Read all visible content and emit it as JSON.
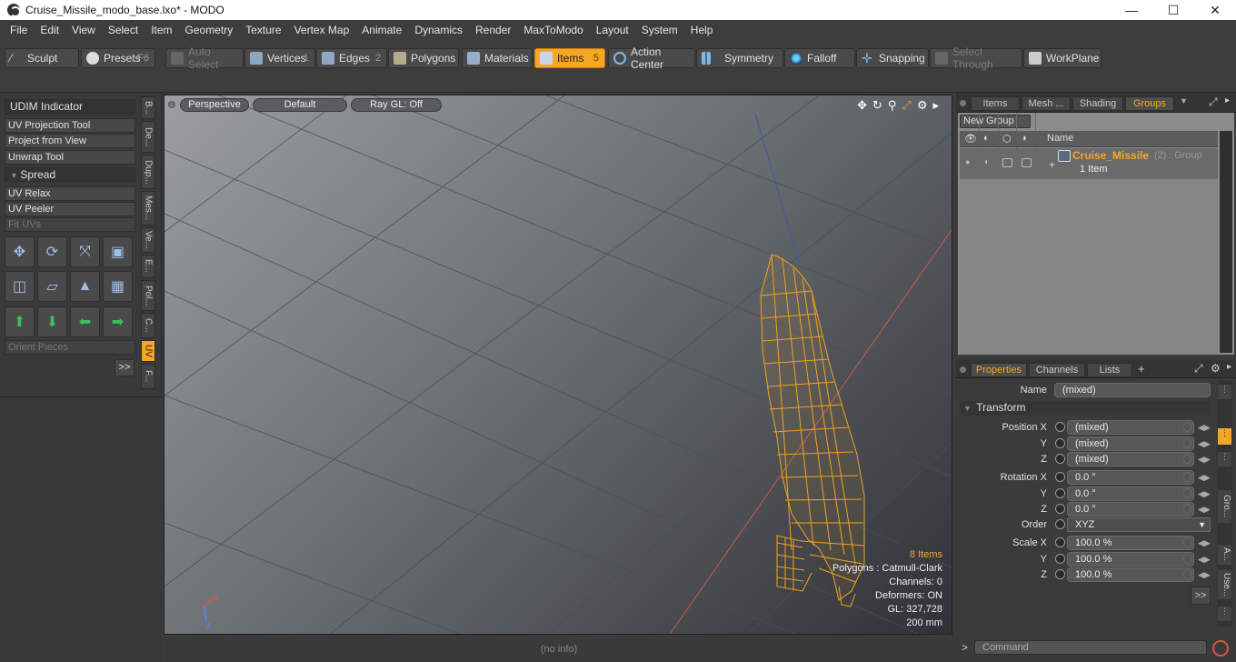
{
  "window": {
    "title": "Cruise_Missile_modo_base.lxo* - MODO",
    "minimize": "—",
    "maximize": "☐",
    "close": "✕"
  },
  "menu": [
    "File",
    "Edit",
    "View",
    "Select",
    "Item",
    "Geometry",
    "Texture",
    "Vertex Map",
    "Animate",
    "Dynamics",
    "Render",
    "MaxToModo",
    "Layout",
    "System",
    "Help"
  ],
  "toolbar": {
    "sculpt": "Sculpt",
    "presets": "Presets",
    "presets_key": "F6",
    "auto_select": "Auto Select",
    "vertices": "Vertices",
    "vertices_num": "1",
    "edges": "Edges",
    "edges_num": "2",
    "polygons": "Polygons",
    "materials": "Materials",
    "items": "Items",
    "items_num": "5",
    "action_center": "Action Center",
    "symmetry": "Symmetry",
    "falloff": "Falloff",
    "snapping": "Snapping",
    "select_through": "Select Through",
    "workplane": "WorkPlane"
  },
  "left_panel": {
    "buttons": [
      "UDIM Indicator",
      "UV Projection Tool",
      "Project from View",
      "Unwrap Tool",
      "Spread",
      "UV Relax",
      "UV Peeler",
      "Fit UVs",
      "Orient Pieces",
      ">>"
    ],
    "side_tabs": [
      "B...",
      "De...",
      "Dup...",
      "Mes...",
      "Ve...",
      "E...",
      "Pol...",
      "C...",
      "UV",
      "F..."
    ]
  },
  "viewport": {
    "view_mode": "Perspective",
    "shading": "Default",
    "ray_gl": "Ray GL: Off",
    "stats": {
      "items": "8 Items",
      "polygons": "Polygons : Catmull-Clark",
      "channels": "Channels: 0",
      "deformers": "Deformers: ON",
      "gl": "GL: 327,728",
      "scale": "200 mm"
    },
    "axis_x": "x",
    "axis_z": "z"
  },
  "status_bar": {
    "info": "(no info)"
  },
  "right_tabs": [
    "Items",
    "Mesh ...",
    "Shading",
    "Groups"
  ],
  "groups": {
    "new_group": "New Group",
    "name_header": "Name",
    "row": {
      "name": "Cruise_Missile",
      "count": "(2)",
      "type": ": Group",
      "sub": "1 Item"
    }
  },
  "properties": {
    "tabs": [
      "Properties",
      "Channels",
      "Lists",
      "+"
    ],
    "name_label": "Name",
    "name_value": "(mixed)",
    "transform": "Transform",
    "position_label": "Position X",
    "position": [
      "(mixed)",
      "(mixed)",
      "(mixed)"
    ],
    "rotation_label": "Rotation X",
    "rotation": [
      "0.0 °",
      "0.0 °",
      "0.0 °"
    ],
    "order_label": "Order",
    "order_value": "XYZ",
    "scale_label": "Scale X",
    "scale": [
      "100.0 %",
      "100.0 %",
      "100.0 %"
    ],
    "y": "Y",
    "z": "Z",
    "more": ">>",
    "side_tabs": [
      "Gro...",
      "A...",
      "Use..."
    ]
  },
  "command": {
    "placeholder": "Command",
    "prompt": ">"
  },
  "colors": {
    "accent": "#f5a623",
    "wire": "#f2a020",
    "bg": "#3b3b3b"
  }
}
